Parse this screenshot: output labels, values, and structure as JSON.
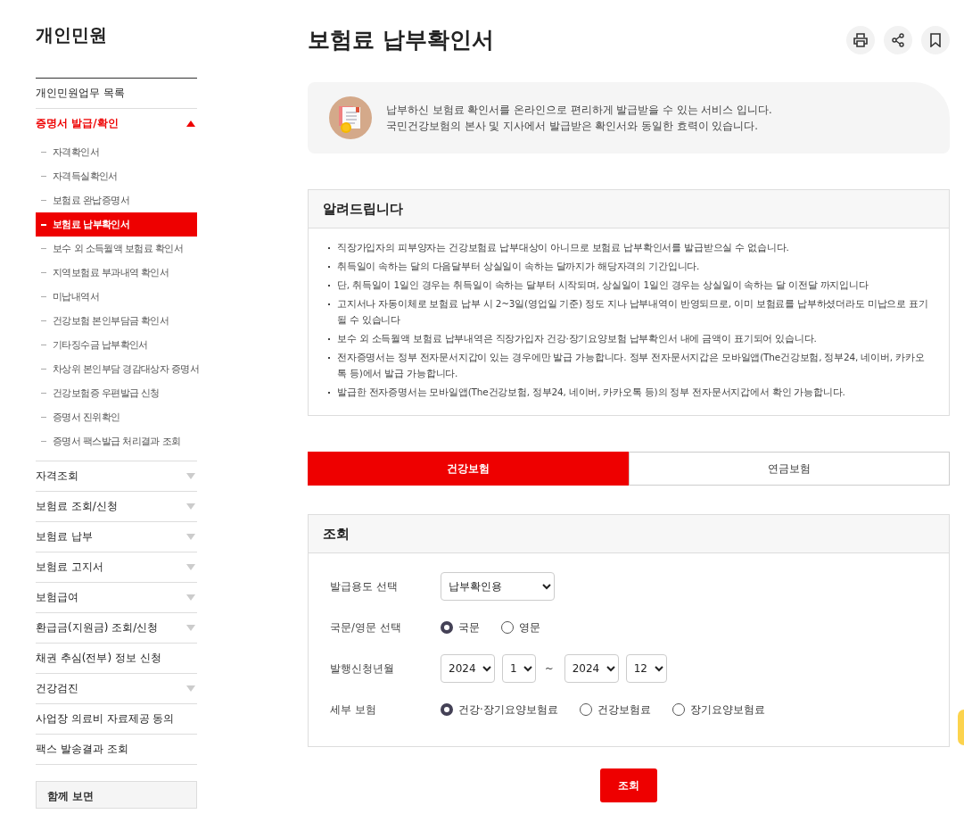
{
  "sidebar": {
    "title": "개인민원",
    "items": [
      {
        "label": "개인민원업무 목록",
        "kind": "link"
      },
      {
        "label": "증명서 발급/확인",
        "kind": "menu",
        "expanded": true,
        "children": [
          {
            "label": "자격확인서",
            "selected": false
          },
          {
            "label": "자격득실확인서",
            "selected": false
          },
          {
            "label": "보험료 완납증명서",
            "selected": false
          },
          {
            "label": "보험료 납부확인서",
            "selected": true
          },
          {
            "label": "보수 외 소득월액 보험료 확인서",
            "selected": false
          },
          {
            "label": "지역보험료 부과내역 확인서",
            "selected": false
          },
          {
            "label": "미납내역서",
            "selected": false
          },
          {
            "label": "건강보험 본인부담금 확인서",
            "selected": false
          },
          {
            "label": "기타징수금 납부확인서",
            "selected": false
          },
          {
            "label": "차상위 본인부담 경감대상자 증명서",
            "selected": false
          },
          {
            "label": "건강보험증 우편발급 신청",
            "selected": false
          },
          {
            "label": "증명서 진위확인",
            "selected": false
          },
          {
            "label": "증명서 팩스발급 처리결과 조회",
            "selected": false
          }
        ]
      },
      {
        "label": "자격조회",
        "kind": "menu",
        "expanded": false
      },
      {
        "label": "보험료 조회/신청",
        "kind": "menu",
        "expanded": false
      },
      {
        "label": "보험료 납부",
        "kind": "menu",
        "expanded": false
      },
      {
        "label": "보험료 고지서",
        "kind": "menu",
        "expanded": false
      },
      {
        "label": "보험급여",
        "kind": "menu",
        "expanded": false
      },
      {
        "label": "환급금(지원금) 조회/신청",
        "kind": "menu",
        "expanded": false
      },
      {
        "label": "채권 추심(전부) 정보 신청",
        "kind": "link"
      },
      {
        "label": "건강검진",
        "kind": "menu",
        "expanded": false
      },
      {
        "label": "사업장 의료비 자료제공 동의",
        "kind": "link"
      },
      {
        "label": "팩스 발송결과 조회",
        "kind": "link"
      }
    ],
    "related": {
      "title": "함께 보면"
    }
  },
  "page_title": "보험료 납부확인서",
  "intro": [
    "납부하신 보험료 확인서를 온라인으로 편리하게 발급받을 수 있는 서비스 입니다.",
    "국민건강보험의 본사 및 지사에서 발급받은 확인서와 동일한 효력이 있습니다."
  ],
  "notice": {
    "title": "알려드립니다",
    "items": [
      "직장가입자의 피부양자는 건강보험료 납부대상이 아니므로 보험료 납부확인서를 발급받으실 수 없습니다.",
      "취득일이 속하는 달의 다음달부터 상실일이 속하는 달까지가 해당자격의 기간입니다.",
      "단, 취득일이 1일인 경우는 취득일이 속하는 달부터 시작되며, 상실일이 1일인 경우는 상실일이 속하는 달 이전달 까지입니다",
      "고지서나 자동이체로 보험료 납부 시 2~3일(영업일 기준) 정도 지나 납부내역이 반영되므로, 이미 보험료를 납부하셨더라도 미납으로 표기될 수 있습니다",
      "보수 외 소득월액 보험료 납부내역은 직장가입자 건강·장기요양보험 납부확인서 내에 금액이 표기되어 있습니다.",
      "전자증명서는 정부 전자문서지갑이 있는 경우에만 발급 가능합니다. 정부 전자문서지갑은 모바일앱(The건강보험, 정부24, 네이버, 카카오톡 등)에서 발급 가능합니다.",
      "발급한 전자증명서는 모바일앱(The건강보험, 정부24, 네이버, 카카오톡 등)의 정부 전자문서지갑에서 확인 가능합니다."
    ]
  },
  "tabs": [
    {
      "label": "건강보험",
      "selected": true
    },
    {
      "label": "연금보험",
      "selected": false
    }
  ],
  "search": {
    "title": "조회",
    "rows": [
      {
        "label": "발급용도 선택",
        "kind": "select",
        "value": "납부확인용"
      },
      {
        "label": "국문/영문 선택",
        "kind": "radio",
        "options": [
          {
            "label": "국문",
            "selected": true
          },
          {
            "label": "영문",
            "selected": false
          }
        ]
      },
      {
        "label": "발행신청년월",
        "kind": "period",
        "from_year": "2024",
        "from_month": "1",
        "separator": "~",
        "to_year": "2024",
        "to_month": "12"
      },
      {
        "label": "세부 보험",
        "kind": "radio",
        "options": [
          {
            "label": "건강·장기요양보험료",
            "selected": true
          },
          {
            "label": "건강보험료",
            "selected": false
          },
          {
            "label": "장기요양보험료",
            "selected": false
          }
        ]
      }
    ],
    "button": "조회"
  }
}
